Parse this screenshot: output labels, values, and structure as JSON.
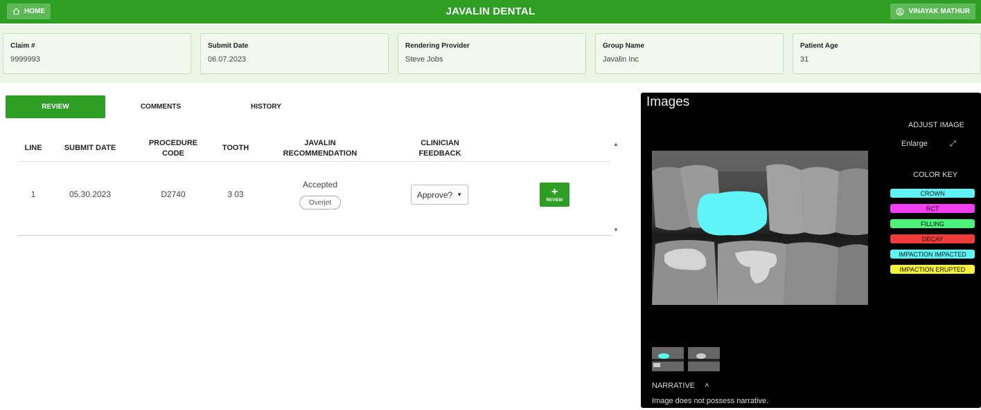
{
  "topbar": {
    "home_label": "HOME",
    "app_title": "JAVALIN DENTAL",
    "user_name": "VINAYAK MATHUR",
    "color": "#2e9e25"
  },
  "claim": {
    "cards": [
      {
        "label": "Claim #",
        "value": "9999993"
      },
      {
        "label": "Submit Date",
        "value": "06.07.2023"
      },
      {
        "label": "Rendering Provider",
        "value": "Steve Jobs"
      },
      {
        "label": "Group Name",
        "value": "Javalin Inc"
      },
      {
        "label": "Patient Age",
        "value": "31"
      }
    ]
  },
  "tabs": [
    {
      "label": "REVIEW",
      "active": true
    },
    {
      "label": "COMMENTS",
      "active": false
    },
    {
      "label": "HISTORY",
      "active": false
    }
  ],
  "table": {
    "headers": {
      "line": "LINE",
      "submit_date": "SUBMIT DATE",
      "procedure_1": "PROCEDURE",
      "procedure_2": "CODE",
      "tooth": "TOOTH",
      "rec_1": "JAVALIN",
      "rec_2": "RECOMMENDATION",
      "feedback_1": "CLINICIAN",
      "feedback_2": "FEEDBACK"
    },
    "rows": [
      {
        "line": "1",
        "submit_date": "05.30.2023",
        "procedure_code": "D2740",
        "tooth": "3 03",
        "recommendation": "Accepted",
        "tag": "Overjet",
        "feedback": "Approve?",
        "action_label": "REVIEW"
      }
    ]
  },
  "images": {
    "title": "Images",
    "adjust_label": "ADJUST IMAGE",
    "enlarge_label": "Enlarge",
    "color_key_label": "COLOR KEY",
    "color_key": [
      {
        "label": "CROWN",
        "color": "#5ff5f7"
      },
      {
        "label": "RCT",
        "color": "#f23ef2"
      },
      {
        "label": "FILLING",
        "color": "#4cf07a"
      },
      {
        "label": "DECAY",
        "color": "#f23b3b"
      },
      {
        "label": "IMPACTION IMPACTED",
        "color": "#5ff5f7"
      },
      {
        "label": "IMPACTION ERUPTED",
        "color": "#f7f23b"
      }
    ],
    "narrative_label": "NARRATIVE",
    "narrative_text": "Image does not possess narrative."
  },
  "icons": {
    "home": "home-icon",
    "user": "user-circle-icon",
    "enlarge": "expand-icon",
    "chevron_up": "chevron-up-icon",
    "caret_down": "caret-down-icon",
    "plus": "plus-icon"
  }
}
